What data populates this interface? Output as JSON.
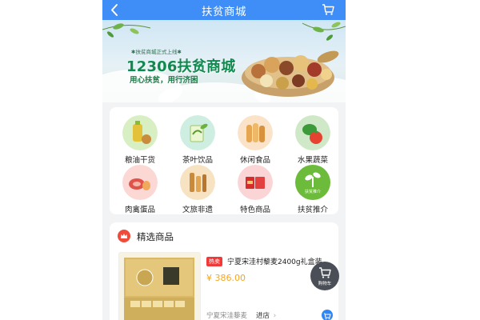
{
  "header": {
    "title": "扶贫商城"
  },
  "banner": {
    "subtitle": "✱扶贫商城正式上线✱",
    "title": "12306扶贫商城",
    "slogan": "用心扶贫，用行济困"
  },
  "categories": [
    {
      "label": "粮油干货",
      "icon": "oil-grain-icon"
    },
    {
      "label": "茶叶饮品",
      "icon": "tea-icon"
    },
    {
      "label": "休闲食品",
      "icon": "snack-icon"
    },
    {
      "label": "水果蔬菜",
      "icon": "fruit-vegetable-icon"
    },
    {
      "label": "肉禽蛋品",
      "icon": "meat-egg-icon"
    },
    {
      "label": "文旅非遗",
      "icon": "culture-travel-icon"
    },
    {
      "label": "特色商品",
      "icon": "specialty-goods-icon"
    },
    {
      "label": "扶贫推介",
      "icon": "poverty-promotion-icon",
      "icon_text": "扶贫推介"
    }
  ],
  "featured": {
    "title": "精选商品",
    "product": {
      "badge": "热卖",
      "name": "宁夏宋洼村藜麦2400g礼盒装",
      "price": "¥ 386.00",
      "shop": "宁夏宋洼藜麦",
      "shop_link": "进店",
      "shop_link_arrow": "›"
    }
  },
  "floating_cart": {
    "label": "购物车"
  },
  "colors": {
    "nav": "#3f8ef7",
    "price": "#f5a524",
    "badge": "#f03a3a"
  }
}
